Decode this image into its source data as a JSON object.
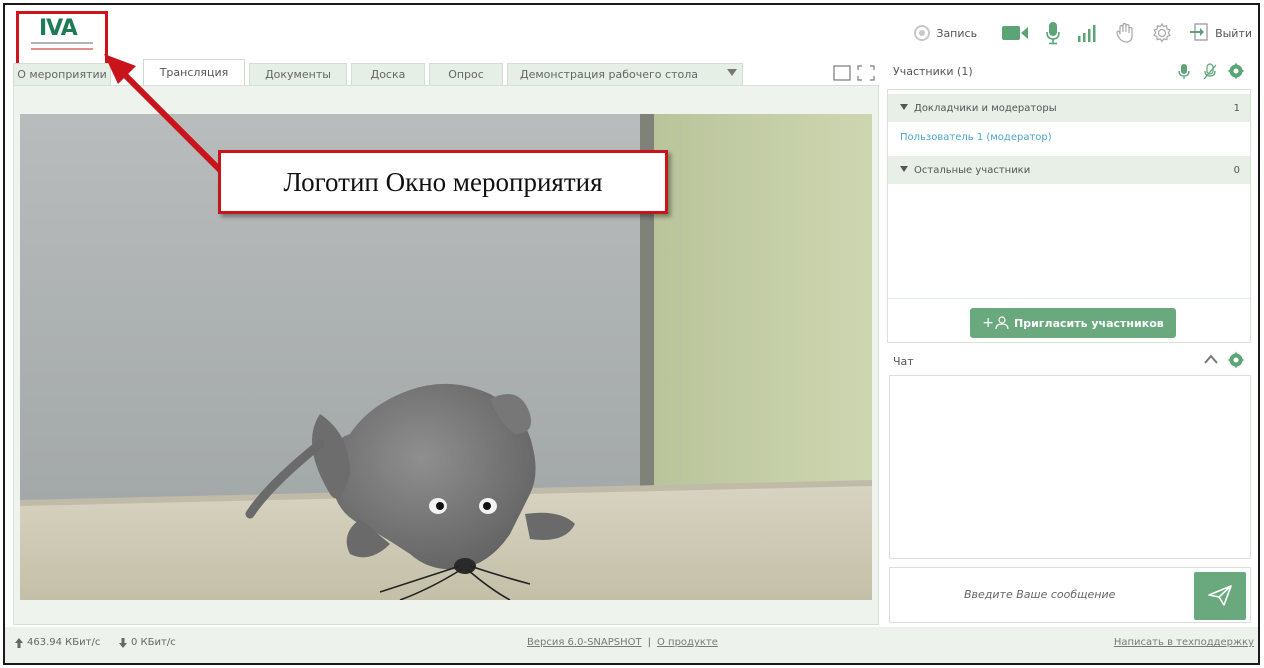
{
  "colors": {
    "accent_green": "#6aa97e",
    "tab_bg": "#e6efe6",
    "annotation_red": "#c8141a",
    "link_blue": "#4aa7c8"
  },
  "logo": {
    "text": "IVA",
    "icon": "iva-logo"
  },
  "topbar": {
    "record_label": "Запись",
    "exit_label": "Выйти",
    "icons": [
      "record-icon",
      "camera-icon",
      "microphone-icon",
      "signal-icon",
      "raise-hand-icon",
      "gear-icon",
      "exit-icon"
    ]
  },
  "tabs": [
    {
      "label": "О мероприятии",
      "active": false
    },
    {
      "label": "Трансляция",
      "active": true
    },
    {
      "label": "Документы",
      "active": false
    },
    {
      "label": "Доска",
      "active": false
    },
    {
      "label": "Опрос",
      "active": false
    },
    {
      "label": "Демонстрация рабочего стола",
      "active": false
    }
  ],
  "participants": {
    "title": "Участники (1)",
    "groups": [
      {
        "label": "Докладчики и модераторы",
        "count": "1"
      },
      {
        "label": "Остальные участники",
        "count": "0"
      }
    ],
    "users": [
      "Пользователь 1 (модератор)"
    ],
    "invite_label": "Пригласить участников"
  },
  "chat": {
    "title": "Чат",
    "placeholder": "Введите Ваше сообщение"
  },
  "statusbar": {
    "upload": "463.94 КБит/с",
    "download": "0 КБит/с",
    "version": "Версия 6.0-SNAPSHOT",
    "separator": "|",
    "about": "О продукте",
    "support": "Написать в техподдержку"
  },
  "annotation": {
    "text": "Логотип Окно мероприятия"
  }
}
